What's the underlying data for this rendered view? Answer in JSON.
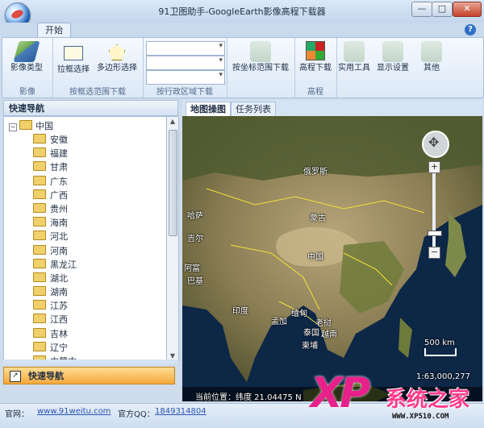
{
  "window": {
    "title": "91卫图助手-GoogleEarth影像高程下载器",
    "min_label": "—",
    "max_label": "□",
    "close_label": "✕"
  },
  "ribbon": {
    "tab": "开始",
    "help": "?",
    "groups": {
      "image": {
        "label": "影像",
        "buttons": [
          "影像类型"
        ]
      },
      "select": {
        "label": "按框选范围下载",
        "buttons": [
          "拉框选择",
          "多边形选择"
        ]
      },
      "region": {
        "label": "按行政区域下载"
      },
      "coord": {
        "buttons": [
          "按坐标范围下载"
        ]
      },
      "elev": {
        "label": "高程",
        "buttons": [
          "高程下载"
        ]
      },
      "tools": {
        "buttons": [
          "实用工具",
          "显示设置",
          "其他"
        ]
      }
    },
    "icons": [
      "layers-icon",
      "rectangle-icon",
      "polygon-icon",
      "coordinate-icon",
      "elevation-icon",
      "tools-icon",
      "display-icon",
      "other-icon"
    ]
  },
  "nav": {
    "header": "快速导航",
    "root": "中国",
    "provinces": [
      "安徽",
      "福建",
      "甘肃",
      "广东",
      "广西",
      "贵州",
      "海南",
      "河北",
      "河南",
      "黑龙江",
      "湖北",
      "湖南",
      "江苏",
      "江西",
      "吉林",
      "辽宁",
      "内蒙古"
    ],
    "footer": "快速导航"
  },
  "map": {
    "tabs": [
      "地图操图",
      "任务列表"
    ],
    "labels": [
      "俄罗斯",
      "蒙古",
      "中国",
      "哈萨",
      "吉尔",
      "阿富",
      "巴基",
      "印度",
      "孟加",
      "缅甸",
      "泰国",
      "越南",
      "老挝",
      "柬埔"
    ],
    "scale_label": "500 km",
    "scale_ratio": "1:63,000,277",
    "status": "当前位置：纬度 21.04475 N",
    "zoom_in": "+",
    "zoom_out": "−",
    "colors": {
      "land": "#6b6a3e",
      "sea": "#0d2747",
      "border": "#f3e13a"
    }
  },
  "statusbar": {
    "site_label": "官网：",
    "site_url": "www.91weitu.com",
    "qq_label": "官方QQ：",
    "qq_value": "1849314804"
  },
  "watermark": {
    "xp": "XP",
    "cn": "系统之家",
    "url": "WWW.XP510.COM"
  }
}
